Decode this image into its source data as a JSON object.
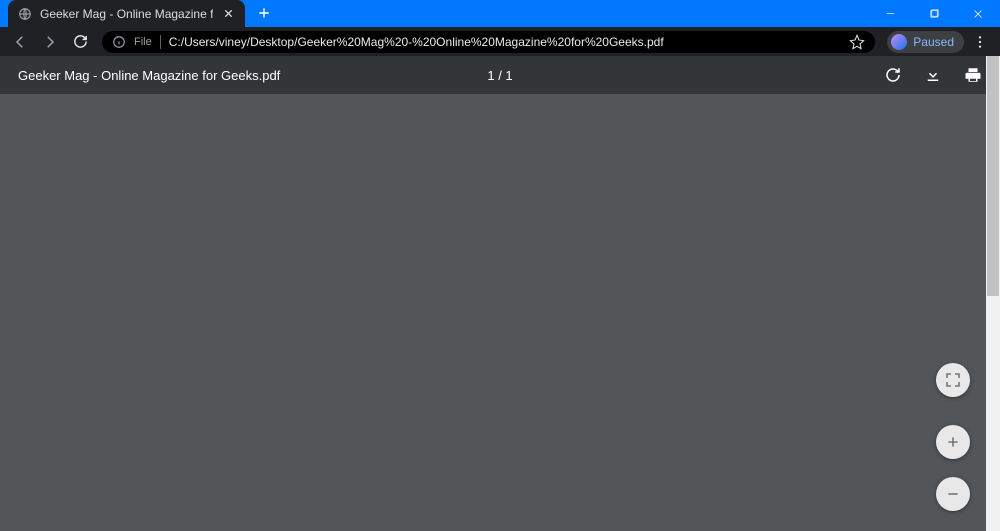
{
  "tab": {
    "title": "Geeker Mag - Online Magazine f"
  },
  "url": {
    "scheme": "File",
    "path": "C:/Users/viney/Desktop/Geeker%20Mag%20-%20Online%20Magazine%20for%20Geeks.pdf"
  },
  "profile": {
    "label": "Paused"
  },
  "pdf": {
    "title": "Geeker Mag - Online Magazine for Geeks.pdf",
    "pages": "1 / 1"
  }
}
